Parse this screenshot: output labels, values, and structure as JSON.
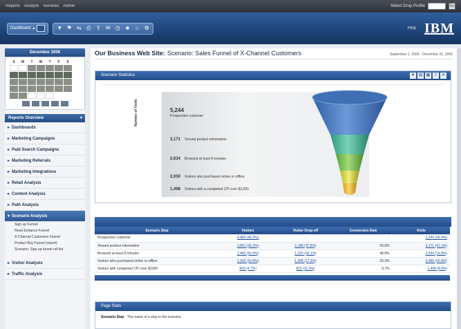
{
  "topbar": {
    "links": [
      "Reports",
      "Analyze",
      "Services",
      "Admin"
    ],
    "user_text": "Select Drop Profile",
    "select_value": "",
    "go_label": "Go"
  },
  "toolbar": {
    "dashboard_label": "Dashboard",
    "icons": [
      "filter-icon",
      "bookmark-icon",
      "compare-icon",
      "print-icon",
      "export-icon",
      "email-icon",
      "schedule-icon",
      "save-icon",
      "home-icon",
      "options-icon"
    ],
    "help_label": "Help",
    "logo_text": "IBM"
  },
  "calendar": {
    "title": "December 2006",
    "days": [
      "S",
      "M",
      "T",
      "W",
      "T",
      "F",
      "S"
    ]
  },
  "nav": {
    "header": "Reports Overview",
    "items": [
      {
        "label": "Dashboards"
      },
      {
        "label": "Marketing Campaigns"
      },
      {
        "label": "Paid Search Campaigns"
      },
      {
        "label": "Marketing Referrals"
      },
      {
        "label": "Marketing Integrations"
      },
      {
        "label": "Retail Analysis"
      },
      {
        "label": "Content Analysis"
      },
      {
        "label": "Path Analysis"
      },
      {
        "label": "Scenario Analysis"
      }
    ],
    "sub_items": [
      "Sign up Funnel",
      "Read Entrance Funnel",
      "X-Channel Customers Funnel",
      "Product Buy Funnel (report)",
      "Scenario: Sign up funnel roll list"
    ],
    "bottom_items": [
      {
        "label": "Visitor Analysis"
      },
      {
        "label": "Traffic Analysis"
      }
    ]
  },
  "page": {
    "title_bold": "Our Business Web Site:",
    "title_rest": "Scenario: Sales Funnel of X-Channel Customers",
    "date_range": "September 1, 2006 - December 31, 2006"
  },
  "scenario_panel": {
    "title": "Scenario Statistics",
    "y_axis_label": "Number of Visits",
    "steps": [
      {
        "value": "5,244",
        "label": "Prospective customer"
      },
      {
        "value": "3,171",
        "label": "Viewed product information"
      },
      {
        "value": "2,634",
        "label": "Browsed at least 8 minutes"
      },
      {
        "value": "2,050",
        "label": "Visitors who purchased online or offline"
      },
      {
        "value": "1,498",
        "label": "Visitors with a completed CPI over $2,000"
      }
    ]
  },
  "table": {
    "headers": [
      "Scenario Step",
      "Visitors",
      "Visitor Drop-off",
      "Conversion Rate",
      "Visits"
    ],
    "rows": [
      [
        "Prospective customer",
        "4,883 (46.0%)",
        "-",
        "-",
        "5,244 (39.4%)"
      ],
      [
        "Viewed product information",
        "3,851 (36.2%)",
        "2,188 (37.8%)",
        "59.8%",
        "3,171 (41.1%)"
      ],
      [
        "Browsed at least 8 minutes",
        "2,460 (20.0%)",
        "1,225 (36.1%)",
        "46.8%",
        "2,634 (19.8%)"
      ],
      [
        "Visitors who purchased online or offline",
        "1,202 (10.0%)",
        "1,208 (17.3%)",
        "25.3%",
        "2,050 (15.8%)"
      ],
      [
        "Visitors with completed CPI over $2000",
        "900 (4.7%)",
        "822 (15.0%)",
        "9.7%",
        "1,498 (8.8%)"
      ]
    ]
  },
  "page_stats": {
    "title": "Page Stats",
    "label": "Scenario Step",
    "text": "- This name of a step in the scenario."
  }
}
